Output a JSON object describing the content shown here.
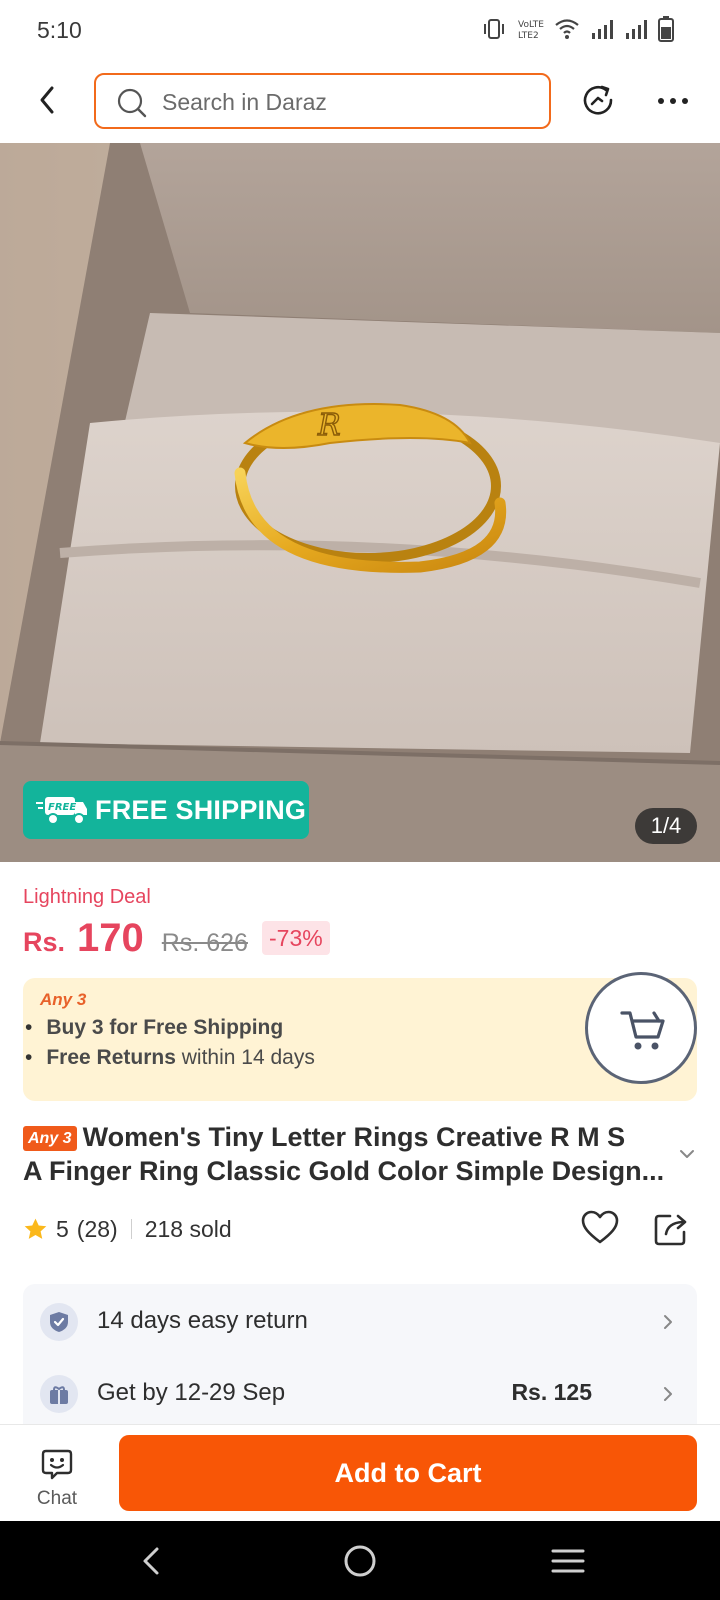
{
  "status_bar": {
    "time": "5:10",
    "network_label": "LTE2"
  },
  "search": {
    "placeholder": "Search in Daraz"
  },
  "gallery": {
    "badge_text": "FREE SHIPPING",
    "badge_icon_text": "FREE",
    "page_indicator": "1/4",
    "ring_engraving": "R"
  },
  "pricing": {
    "deal_label": "Lightning Deal",
    "currency": "Rs.",
    "price": "170",
    "old_price": "Rs. 626",
    "discount": "-73%"
  },
  "promo": {
    "tag": "Any 3",
    "line1_bold": "Buy 3 for  Free Shipping",
    "line2_bold": "Free Returns",
    "line2_rest": " within 14 days"
  },
  "product": {
    "badge": "Any 3",
    "title_line1": "Women's Tiny Letter Rings Creative R M S",
    "title_line2": "A Finger Ring Classic Gold Color Simple Design..."
  },
  "rating": {
    "score": "5",
    "count": "(28)",
    "sold": "218 sold"
  },
  "services": {
    "return_text": "14 days easy return",
    "delivery_text": "Get by 12-29 Sep",
    "delivery_fee": "Rs. 125"
  },
  "bottom_bar": {
    "chat_label": "Chat",
    "add_to_cart": "Add to Cart"
  },
  "colors": {
    "accent_orange": "#f85606",
    "price_red": "#e6455e",
    "free_shipping_green": "#13b49b",
    "promo_bg": "#fff3d4"
  },
  "icons": [
    "back-icon",
    "search-icon",
    "history-icon",
    "more-icon",
    "cart-icon",
    "star-icon",
    "heart-icon",
    "share-icon",
    "shield-icon",
    "gift-icon",
    "chevron-right-icon",
    "chat-icon"
  ]
}
